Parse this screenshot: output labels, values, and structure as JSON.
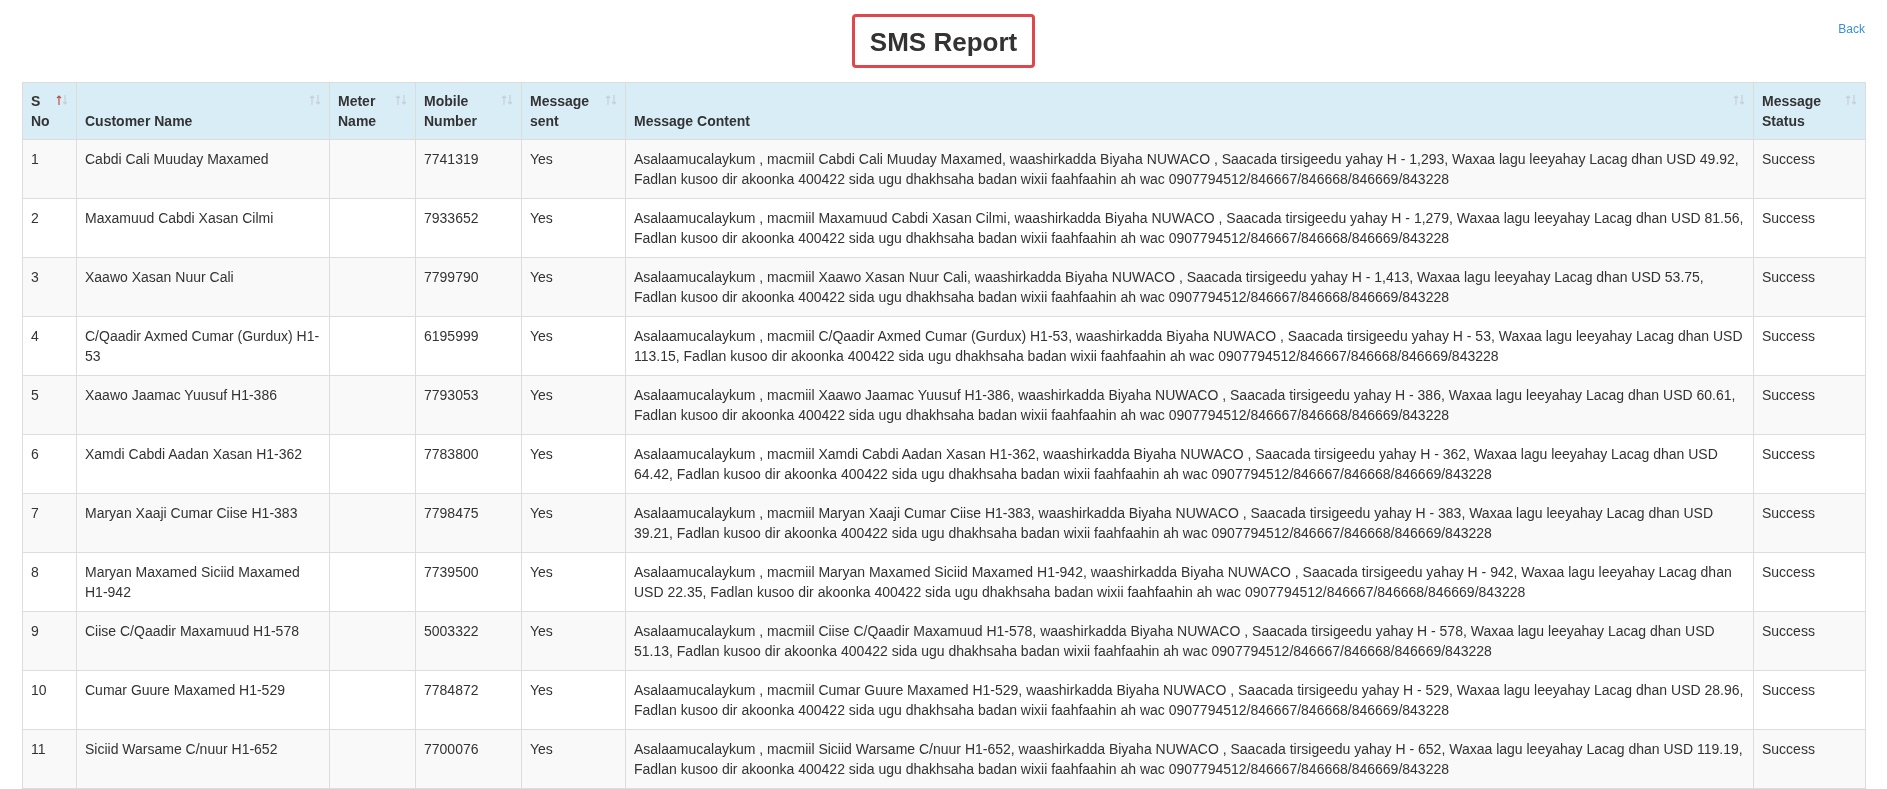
{
  "title": "SMS Report",
  "back_link": "Back",
  "table": {
    "columns": [
      {
        "label": "S No",
        "sorted": true
      },
      {
        "label": "Customer Name",
        "sorted": false
      },
      {
        "label": "Meter Name",
        "sorted": false
      },
      {
        "label": "Mobile Number",
        "sorted": false
      },
      {
        "label": "Message sent",
        "sorted": false
      },
      {
        "label": "Message Content",
        "sorted": false
      },
      {
        "label": "Message Status",
        "sorted": false
      }
    ],
    "rows": [
      {
        "s_no": "1",
        "customer_name": "Cabdi Cali Muuday Maxamed",
        "mobile_number": "7741319",
        "message_sent": "Yes",
        "message_content": "Asalaamucalaykum , macmiil Cabdi Cali Muuday Maxamed, waashirkadda Biyaha NUWACO , Saacada tirsigeedu yahay H - 1,293, Waxaa lagu leeyahay Lacag dhan USD 49.92, Fadlan kusoo dir akoonka 400422 sida ugu dhakhsaha badan wixii faahfaahin ah wac 0907794512/846667/846668/846669/843228",
        "message_status": "Success"
      },
      {
        "s_no": "2",
        "customer_name": "Maxamuud Cabdi Xasan Cilmi",
        "mobile_number": "7933652",
        "message_sent": "Yes",
        "message_content": "Asalaamucalaykum , macmiil Maxamuud Cabdi Xasan Cilmi, waashirkadda Biyaha NUWACO , Saacada tirsigeedu yahay H - 1,279, Waxaa lagu leeyahay Lacag dhan USD 81.56, Fadlan kusoo dir akoonka 400422 sida ugu dhakhsaha badan wixii faahfaahin ah wac 0907794512/846667/846668/846669/843228",
        "message_status": "Success"
      },
      {
        "s_no": "3",
        "customer_name": "Xaawo Xasan Nuur Cali",
        "mobile_number": "7799790",
        "message_sent": "Yes",
        "message_content": "Asalaamucalaykum , macmiil Xaawo Xasan Nuur Cali, waashirkadda Biyaha NUWACO , Saacada tirsigeedu yahay H - 1,413, Waxaa lagu leeyahay Lacag dhan USD 53.75, Fadlan kusoo dir akoonka 400422 sida ugu dhakhsaha badan wixii faahfaahin ah wac 0907794512/846667/846668/846669/843228",
        "message_status": "Success"
      },
      {
        "s_no": "4",
        "customer_name": "C/Qaadir Axmed Cumar (Gurdux) H1-53",
        "mobile_number": "6195999",
        "message_sent": "Yes",
        "message_content": "Asalaamucalaykum , macmiil C/Qaadir Axmed Cumar (Gurdux) H1-53, waashirkadda Biyaha NUWACO , Saacada tirsigeedu yahay H - 53, Waxaa lagu leeyahay Lacag dhan USD 113.15, Fadlan kusoo dir akoonka 400422 sida ugu dhakhsaha badan wixii faahfaahin ah wac 0907794512/846667/846668/846669/843228",
        "message_status": "Success"
      },
      {
        "s_no": "5",
        "customer_name": "Xaawo Jaamac Yuusuf H1-386",
        "mobile_number": "7793053",
        "message_sent": "Yes",
        "message_content": "Asalaamucalaykum , macmiil Xaawo Jaamac Yuusuf H1-386, waashirkadda Biyaha NUWACO , Saacada tirsigeedu yahay H - 386, Waxaa lagu leeyahay Lacag dhan USD 60.61, Fadlan kusoo dir akoonka 400422 sida ugu dhakhsaha badan wixii faahfaahin ah wac 0907794512/846667/846668/846669/843228",
        "message_status": "Success"
      },
      {
        "s_no": "6",
        "customer_name": "Xamdi Cabdi Aadan Xasan H1-362",
        "mobile_number": "7783800",
        "message_sent": "Yes",
        "message_content": "Asalaamucalaykum , macmiil Xamdi Cabdi Aadan Xasan H1-362, waashirkadda Biyaha NUWACO , Saacada tirsigeedu yahay H - 362, Waxaa lagu leeyahay Lacag dhan USD 64.42, Fadlan kusoo dir akoonka 400422 sida ugu dhakhsaha badan wixii faahfaahin ah wac 0907794512/846667/846668/846669/843228",
        "message_status": "Success"
      },
      {
        "s_no": "7",
        "customer_name": "Maryan Xaaji Cumar Ciise H1-383",
        "mobile_number": "7798475",
        "message_sent": "Yes",
        "message_content": "Asalaamucalaykum , macmiil Maryan Xaaji Cumar Ciise H1-383, waashirkadda Biyaha NUWACO , Saacada tirsigeedu yahay H - 383, Waxaa lagu leeyahay Lacag dhan USD 39.21, Fadlan kusoo dir akoonka 400422 sida ugu dhakhsaha badan wixii faahfaahin ah wac 0907794512/846667/846668/846669/843228",
        "message_status": "Success"
      },
      {
        "s_no": "8",
        "customer_name": "Maryan Maxamed Siciid Maxamed H1-942",
        "mobile_number": "7739500",
        "message_sent": "Yes",
        "message_content": "Asalaamucalaykum , macmiil Maryan Maxamed Siciid Maxamed H1-942, waashirkadda Biyaha NUWACO , Saacada tirsigeedu yahay H - 942, Waxaa lagu leeyahay Lacag dhan USD 22.35, Fadlan kusoo dir akoonka 400422 sida ugu dhakhsaha badan wixii faahfaahin ah wac 0907794512/846667/846668/846669/843228",
        "message_status": "Success"
      },
      {
        "s_no": "9",
        "customer_name": "Ciise C/Qaadir Maxamuud H1-578",
        "mobile_number": "5003322",
        "message_sent": "Yes",
        "message_content": "Asalaamucalaykum , macmiil Ciise C/Qaadir Maxamuud H1-578, waashirkadda Biyaha NUWACO , Saacada tirsigeedu yahay H - 578, Waxaa lagu leeyahay Lacag dhan USD 51.13, Fadlan kusoo dir akoonka 400422 sida ugu dhakhsaha badan wixii faahfaahin ah wac 0907794512/846667/846668/846669/843228",
        "message_status": "Success"
      },
      {
        "s_no": "10",
        "customer_name": "Cumar Guure Maxamed H1-529",
        "mobile_number": "7784872",
        "message_sent": "Yes",
        "message_content": "Asalaamucalaykum , macmiil Cumar Guure Maxamed H1-529, waashirkadda Biyaha NUWACO , Saacada tirsigeedu yahay H - 529, Waxaa lagu leeyahay Lacag dhan USD 28.96, Fadlan kusoo dir akoonka 400422 sida ugu dhakhsaha badan wixii faahfaahin ah wac 0907794512/846667/846668/846669/843228",
        "message_status": "Success"
      },
      {
        "s_no": "11",
        "customer_name": "Siciid Warsame C/nuur H1-652",
        "mobile_number": "7700076",
        "message_sent": "Yes",
        "message_content": "Asalaamucalaykum , macmiil Siciid Warsame C/nuur H1-652, waashirkadda Biyaha NUWACO , Saacada tirsigeedu yahay H - 652, Waxaa lagu leeyahay Lacag dhan USD 119.19, Fadlan kusoo dir akoonka 400422 sida ugu dhakhsaha badan wixii faahfaahin ah wac 0907794512/846667/846668/846669/843228",
        "message_status": "Success"
      }
    ]
  }
}
